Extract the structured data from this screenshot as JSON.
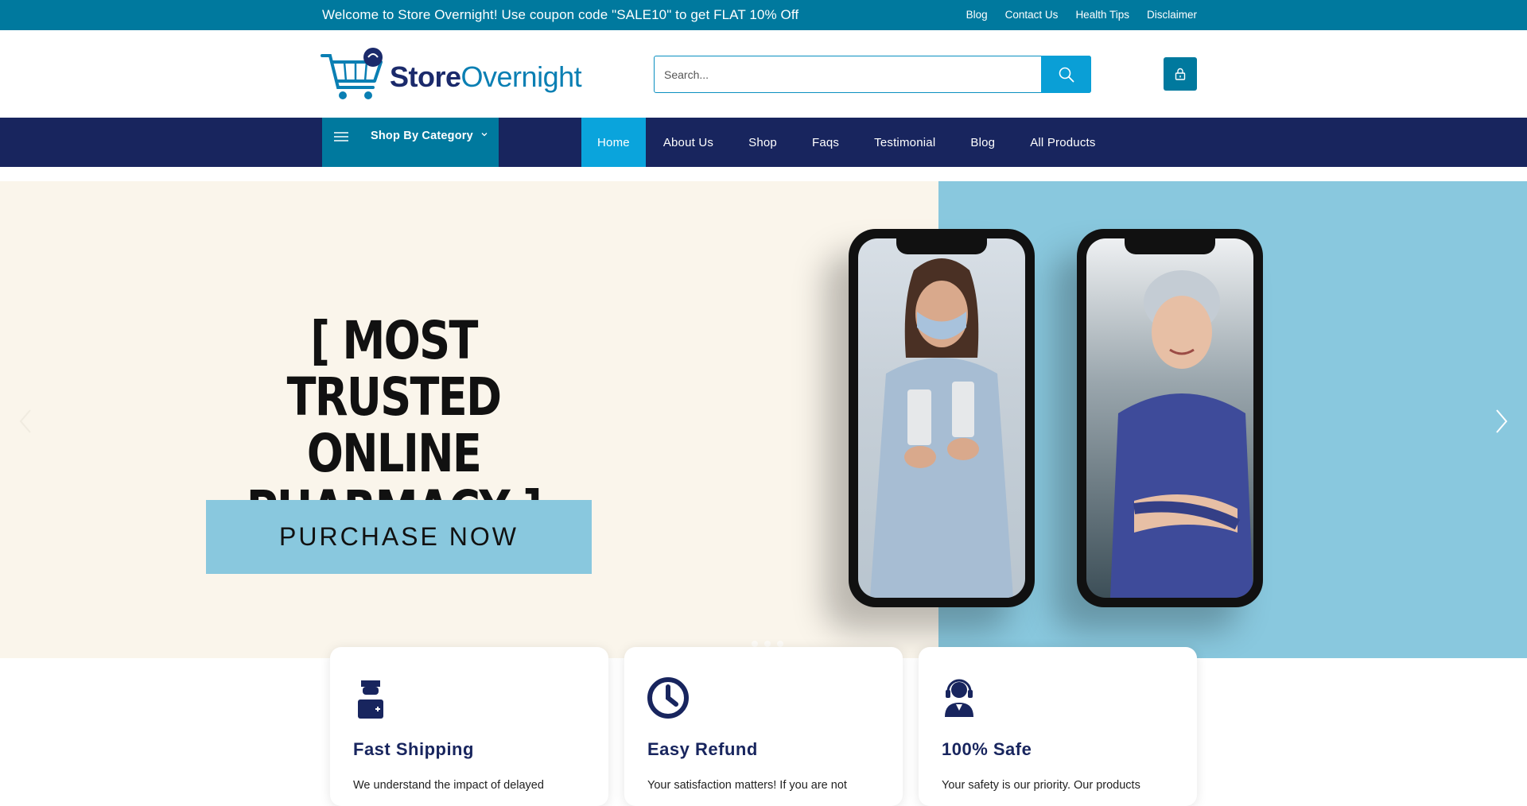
{
  "topbar": {
    "welcome": "Welcome to Store Overnight! Use coupon code \"SALE10\" to get FLAT 10% Off",
    "links": [
      "Blog",
      "Contact Us",
      "Health Tips",
      "Disclaimer"
    ]
  },
  "header": {
    "logo_part1": "Store",
    "logo_part2": "Overnight",
    "search_placeholder": "Search...",
    "search_icon": "search-icon",
    "account_icon": "lock-icon"
  },
  "nav": {
    "category_label": "Shop By Category",
    "items": [
      "Home",
      "About Us",
      "Shop",
      "Faqs",
      "Testimonial",
      "Blog",
      "All Products"
    ],
    "active": "Home"
  },
  "hero": {
    "headline_line1": "[ MOST  TRUSTED",
    "headline_line2": "ONLINE",
    "headline_line3": "PHARMACY ]",
    "cta_label": "PURCHASE NOW"
  },
  "features": [
    {
      "title": "Fast Shipping",
      "desc": "We understand the impact of delayed",
      "icon": "doctor-icon"
    },
    {
      "title": "Easy Refund",
      "desc": "Your satisfaction matters! If you are not",
      "icon": "clock-icon"
    },
    {
      "title": "100% Safe",
      "desc": "Your safety is our priority. Our products",
      "icon": "support-agent-icon"
    }
  ],
  "colors": {
    "topbar": "#00799e",
    "nav": "#18255e",
    "accent": "#0aa4dc",
    "hero_bg": "#faf5eb",
    "hero_panel": "#89c8de"
  }
}
